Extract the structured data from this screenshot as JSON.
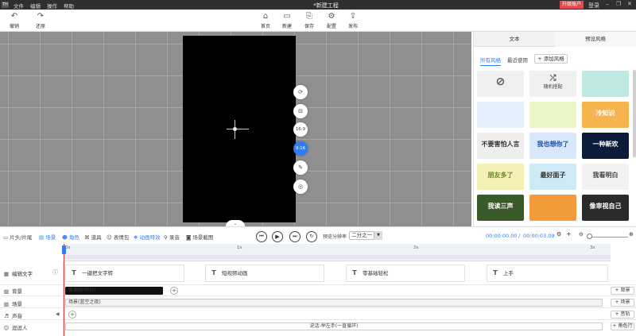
{
  "menubar": {
    "logo": "TH",
    "menus": [
      "文件",
      "编辑",
      "操作",
      "帮助"
    ],
    "title": "*新建工程",
    "upgrade": "升级账户",
    "login": "登录",
    "win": [
      "–",
      "❐",
      "✕"
    ]
  },
  "toolbar": {
    "undo": "撤销",
    "redo": "还原",
    "home": "首页",
    "new": "新建",
    "save": "保存",
    "config": "配置",
    "publish": "发布"
  },
  "canvas_controls": [
    "⟳",
    "⊟",
    "16:9",
    "9:16",
    "✎",
    "◎"
  ],
  "panel": {
    "tabs": [
      "文本",
      "预设风格"
    ],
    "filters": [
      "所有风格",
      "最近使用"
    ],
    "add_style": "+ 添加风格",
    "random_label": "随机搭配",
    "thumbs": [
      {
        "text": "",
        "bg": "#f0f0f0",
        "fg": "#666"
      },
      {
        "text": "",
        "bg": "#f0f0f0",
        "fg": "#666"
      },
      {
        "text": "",
        "bg": "#bfe8e3",
        "fg": "#333"
      },
      {
        "text": "",
        "bg": "#e4f0fb",
        "fg": "#3a7bd5"
      },
      {
        "text": "",
        "bg": "#eaf6c8",
        "fg": "#6a8a1a"
      },
      {
        "text": "冷知识",
        "bg": "#f7b34e",
        "fg": "#fff"
      },
      {
        "text": "不要害怕人言",
        "bg": "#eeeeee",
        "fg": "#333"
      },
      {
        "text": "我也想你了",
        "bg": "#d9e7fb",
        "fg": "#1d4fa3"
      },
      {
        "text": "一种新欢",
        "bg": "#0d1b3b",
        "fg": "#fff"
      },
      {
        "text": "朋友多了",
        "bg": "#f4efb5",
        "fg": "#6c8a2a"
      },
      {
        "text": "最好面子",
        "bg": "#cfeaf6",
        "fg": "#333"
      },
      {
        "text": "我看明白",
        "bg": "#f2f2f2",
        "fg": "#444"
      },
      {
        "text": "我读三声",
        "bg": "#3a5a2a",
        "fg": "#fff"
      },
      {
        "text": "",
        "bg": "#f39a3a",
        "fg": "#fff"
      },
      {
        "text": "像审视自己",
        "bg": "#2a2a2a",
        "fg": "#fff"
      }
    ]
  },
  "transport": {
    "items": [
      "片头/片尾",
      "场景",
      "角色",
      "道具",
      "表情包",
      "动画特效",
      "录音",
      "场景截图"
    ],
    "ratio_label": "预览分辨率",
    "ratio_value": "二分之一",
    "time_current": "00:00:00.00",
    "time_sep": "/",
    "time_total": "00:00:03.09"
  },
  "ruler": {
    "ticks": [
      "0s",
      "1s",
      "2s",
      "3s"
    ]
  },
  "tracks": {
    "labels": [
      "编辑文字",
      "背景",
      "场景",
      "声音",
      "逗逗人"
    ],
    "text_clips": [
      "一键把文字转",
      "短视频动画",
      "零基础轻松",
      "上手"
    ],
    "bg_clip": "背景图(默认)",
    "scene_clip": "场景(蓝空之夜)",
    "person_clip": "说话-举左手(一直循环)",
    "side_buttons": [
      "+ 背景",
      "+ 场景",
      "+ 音轨",
      "+ 角色行"
    ]
  }
}
